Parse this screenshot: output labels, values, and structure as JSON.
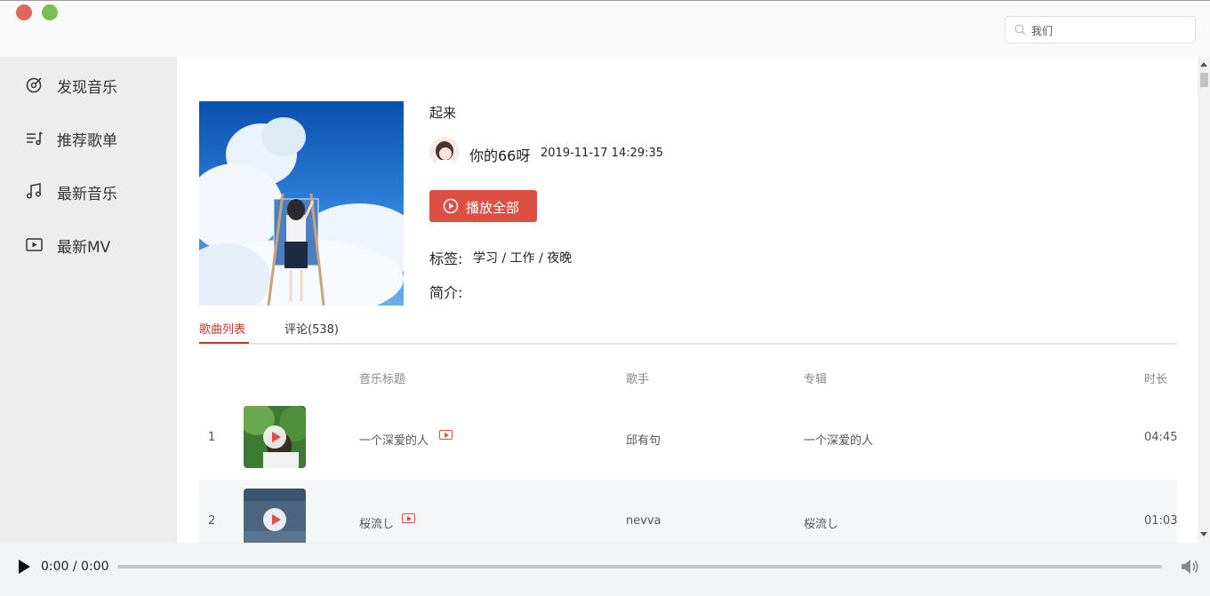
{
  "window": {
    "close_color": "#e2665d",
    "maximize_color": "#7cbd54"
  },
  "search": {
    "value": "我们",
    "placeholder": ""
  },
  "sidebar": {
    "items": [
      {
        "label": "发现音乐",
        "icon": "disc-icon"
      },
      {
        "label": "推荐歌单",
        "icon": "playlist-icon"
      },
      {
        "label": "最新音乐",
        "icon": "music-note-icon"
      },
      {
        "label": "最新MV",
        "icon": "video-icon"
      }
    ]
  },
  "playlist": {
    "title": "起来",
    "creator": "你的66呀",
    "created_at": "2019-11-17 14:29:35",
    "play_all_label": "播放全部",
    "tags_label": "标签:",
    "tags": "学习 / 工作 / 夜晚",
    "desc_label": "简介:"
  },
  "tabs": [
    {
      "label": "歌曲列表",
      "active": true
    },
    {
      "label": "评论(538)",
      "active": false
    }
  ],
  "table": {
    "headers": {
      "title": "音乐标题",
      "artist": "歌手",
      "album": "专辑",
      "duration": "时长"
    },
    "rows": [
      {
        "index": "1",
        "title": "一个深爱的人",
        "artist": "邱有句",
        "album": "一个深爱的人",
        "duration": "04:45",
        "has_mv": true
      },
      {
        "index": "2",
        "title": "桜流し",
        "artist": "nevva",
        "album": "桜流し",
        "duration": "01:03",
        "has_mv": true
      }
    ]
  },
  "player": {
    "time": "0:00 / 0:00",
    "progress": 0
  },
  "colors": {
    "accent": "#dd4f43",
    "sidebar_bg": "#ededed"
  }
}
